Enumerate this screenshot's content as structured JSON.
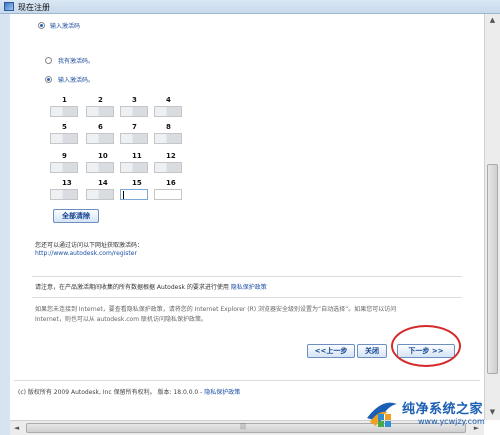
{
  "window": {
    "title": "现在注册"
  },
  "top_option": {
    "label": "输入激活码"
  },
  "options": [
    {
      "label": "我有激活码。",
      "selected": false
    },
    {
      "label": "输入激活码。",
      "selected": true
    }
  ],
  "grid": {
    "numbers": [
      "1",
      "2",
      "3",
      "4",
      "5",
      "6",
      "7",
      "8",
      "9",
      "10",
      "11",
      "12",
      "13",
      "14",
      "15",
      "16"
    ],
    "filled_count": 14,
    "active_index": 14
  },
  "clear_all_button": "全部清除",
  "info": {
    "visit_text": "您还可以通过访问以下网址获取激活码：",
    "url": "http://www.autodesk.com/register"
  },
  "notice": {
    "line1_prefix": "请注意，在产品激活期间收集的所有数据根据  Autodesk 的要求进行使用",
    "line1_link": "隐私保护政策",
    "line2": "如果您未连接到  Internet，要查看隐私保护政策，请将您的  Internet Explorer (R) 浏览器安全级别设置为“自动选择”。如果您可以访问",
    "line3": "Internet，则也可以从  autodesk.com 联机访问隐私保护政策。"
  },
  "buttons": {
    "back": "<<上一步",
    "close": "关闭",
    "next": "下一步 >>"
  },
  "footer": {
    "text": "(c) 版权所有  2009 Autodesk, Inc 保留所有权利。   版本: 18.0.0.0 - ",
    "link": "隐私保护政策"
  },
  "watermark": {
    "title": "纯净系统之家",
    "url": "www.ycwjzy.com"
  },
  "colors": {
    "accent": "#1c4fa6",
    "highlight_circle": "#d42a2a",
    "button_text": "#0c3d8e"
  },
  "scroll": {
    "vertical": {
      "up": "▲",
      "down": "▼"
    },
    "horizontal": {
      "left": "◄",
      "right": "►",
      "grip": "|||"
    }
  }
}
